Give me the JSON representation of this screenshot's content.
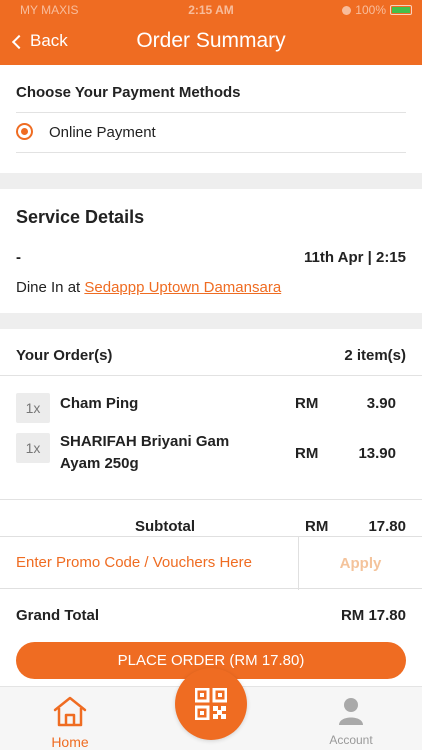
{
  "status_bar": {
    "carrier": "MY MAXIS",
    "time": "2:15 AM",
    "battery": "100%"
  },
  "header": {
    "back_label": "Back",
    "title": "Order Summary"
  },
  "payment": {
    "heading": "Choose Your Payment Methods",
    "method": "Online Payment",
    "selected": true
  },
  "service": {
    "heading": "Service Details",
    "dash": "-",
    "datetime": "11th Apr | 2:15",
    "dine_prefix": "Dine In at ",
    "location": "Sedappp Uptown Damansara"
  },
  "orders": {
    "heading": "Your Order(s)",
    "count": "2 item(s)",
    "items": [
      {
        "qty": "1x",
        "name": "Cham Ping",
        "currency": "RM",
        "price": "3.90"
      },
      {
        "qty": "1x",
        "name": "SHARIFAH Briyani Gam Ayam 250g",
        "currency": "RM",
        "price": "13.90"
      }
    ],
    "subtotal_label": "Subtotal",
    "subtotal_currency": "RM",
    "subtotal_value": "17.80"
  },
  "promo": {
    "placeholder": "Enter Promo Code / Vouchers Here",
    "apply_label": "Apply"
  },
  "grand_total": {
    "label": "Grand Total",
    "value": "RM 17.80"
  },
  "place_order_label": "PLACE ORDER (RM 17.80)",
  "nav": {
    "home_label": "Home",
    "account_label": "Account"
  },
  "colors": {
    "accent": "#ef6c22",
    "background_gap": "#eeeeee",
    "battery": "#43c04a"
  },
  "icons": [
    "chevron-left-icon",
    "radio-selected-icon",
    "home-icon",
    "qr-code-icon",
    "account-icon"
  ]
}
